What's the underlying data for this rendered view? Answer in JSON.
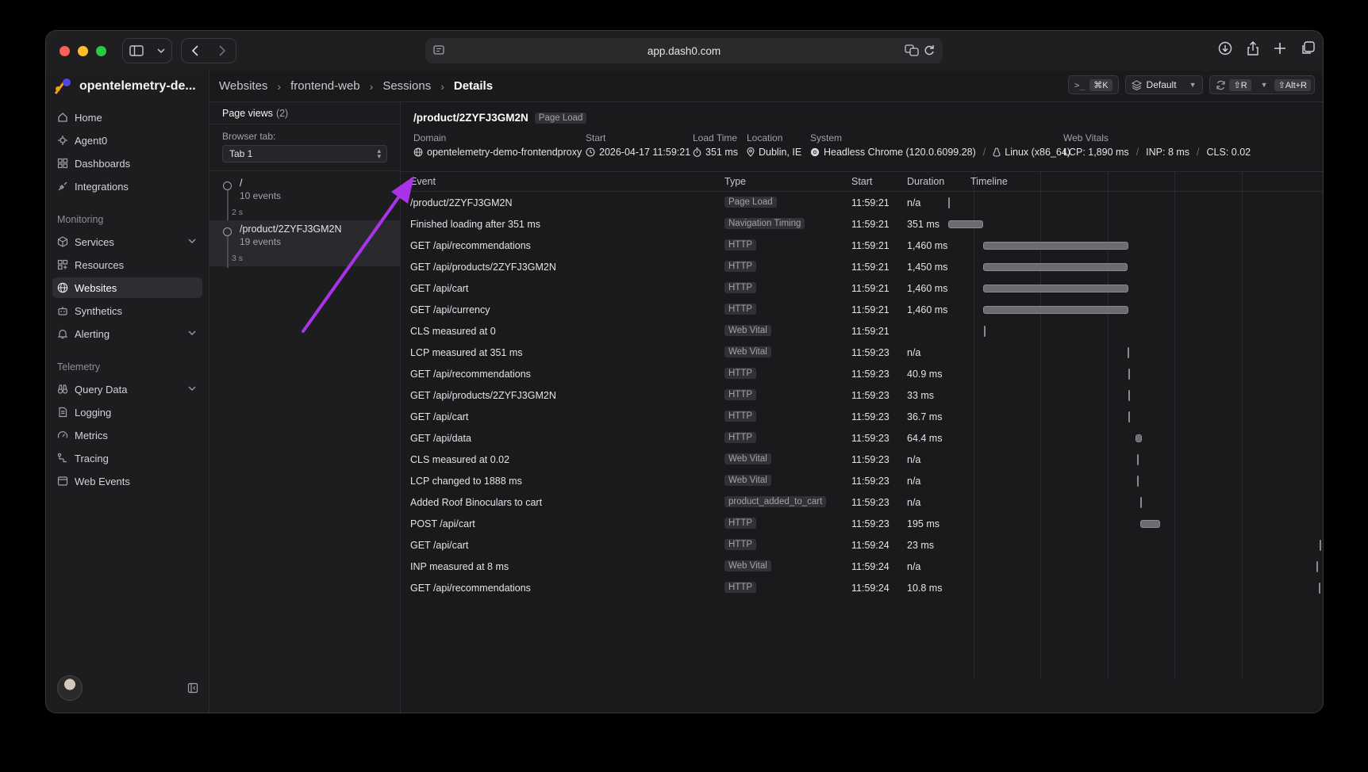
{
  "browser": {
    "url": "app.dash0.com"
  },
  "sidebar": {
    "org_name": "opentelemetry-de...",
    "main_items": [
      {
        "label": "Home",
        "icon": "home-icon"
      },
      {
        "label": "Agent0",
        "icon": "agent-icon"
      },
      {
        "label": "Dashboards",
        "icon": "dashboard-icon"
      },
      {
        "label": "Integrations",
        "icon": "plug-icon"
      }
    ],
    "monitoring_heading": "Monitoring",
    "monitoring_items": [
      {
        "label": "Services",
        "icon": "cube-icon",
        "expandable": true
      },
      {
        "label": "Resources",
        "icon": "grid-icon"
      },
      {
        "label": "Websites",
        "icon": "globe-icon",
        "active": true
      },
      {
        "label": "Synthetics",
        "icon": "robot-icon"
      },
      {
        "label": "Alerting",
        "icon": "bell-icon",
        "expandable": true
      }
    ],
    "telemetry_heading": "Telemetry",
    "telemetry_items": [
      {
        "label": "Query Data",
        "icon": "binoculars-icon",
        "expandable": true
      },
      {
        "label": "Logging",
        "icon": "log-icon"
      },
      {
        "label": "Metrics",
        "icon": "gauge-icon"
      },
      {
        "label": "Tracing",
        "icon": "trace-icon"
      },
      {
        "label": "Web Events",
        "icon": "window-icon"
      }
    ]
  },
  "breadcrumb": [
    "Websites",
    "frontend-web",
    "Sessions",
    "Details"
  ],
  "toolbar": {
    "command_kbd": "⌘K",
    "default_label": "Default",
    "refresh_kbd": "⇧R",
    "alt_kbd": "⇧Alt+R"
  },
  "page_views": {
    "title": "Page views",
    "count": "(2)",
    "browser_tab_label": "Browser tab:",
    "browser_tab_value": "Tab 1",
    "items": [
      {
        "path": "/",
        "events": "10 events",
        "duration": "2 s"
      },
      {
        "path": "/product/2ZYFJ3GM2N",
        "events": "19 events",
        "duration": "3 s"
      }
    ]
  },
  "detail": {
    "title": "/product/2ZYFJ3GM2N",
    "title_tag": "Page Load",
    "domain_label": "Domain",
    "domain_value": "opentelemetry-demo-frontendproxy",
    "start_label": "Start",
    "start_value": "2026-04-17 11:59:21",
    "load_label": "Load Time",
    "load_value": "351 ms",
    "location_label": "Location",
    "location_value": "Dublin, IE",
    "system_label": "System",
    "system_browser": "Headless Chrome (120.0.6099.28)",
    "system_os": "Linux (x86_64)",
    "vitals_label": "Web Vitals",
    "vitals_lcp": "LCP: 1,890 ms",
    "vitals_inp": "INP: 8 ms",
    "vitals_cls": "CLS: 0.02"
  },
  "table": {
    "headers": {
      "event": "Event",
      "type": "Type",
      "start": "Start",
      "duration": "Duration",
      "timeline": "Timeline"
    },
    "rows": [
      {
        "event": "/product/2ZYFJ3GM2N",
        "type": "Page Load",
        "start": "11:59:21",
        "duration": "n/a",
        "tl_start": 0,
        "tl_len": 0
      },
      {
        "event": "Finished loading after 351 ms",
        "type": "Navigation Timing",
        "start": "11:59:21",
        "duration": "351 ms",
        "tl_start": 0,
        "tl_len": 351
      },
      {
        "event": "GET /api/recommendations",
        "type": "HTTP",
        "start": "11:59:21",
        "duration": "1,460 ms",
        "tl_start": 351,
        "tl_len": 1460
      },
      {
        "event": "GET /api/products/2ZYFJ3GM2N",
        "type": "HTTP",
        "start": "11:59:21",
        "duration": "1,450 ms",
        "tl_start": 351,
        "tl_len": 1450
      },
      {
        "event": "GET /api/cart",
        "type": "HTTP",
        "start": "11:59:21",
        "duration": "1,460 ms",
        "tl_start": 351,
        "tl_len": 1460
      },
      {
        "event": "GET /api/currency",
        "type": "HTTP",
        "start": "11:59:21",
        "duration": "1,460 ms",
        "tl_start": 351,
        "tl_len": 1460
      },
      {
        "event": "CLS measured at 0",
        "type": "Web Vital",
        "start": "11:59:21",
        "duration": "",
        "tl_start": 360,
        "tl_len": 0
      },
      {
        "event": "LCP measured at 351 ms",
        "type": "Web Vital",
        "start": "11:59:23",
        "duration": "n/a",
        "tl_start": 1800,
        "tl_len": 0
      },
      {
        "event": "GET /api/recommendations",
        "type": "HTTP",
        "start": "11:59:23",
        "duration": "40.9 ms",
        "tl_start": 1810,
        "tl_len": 41
      },
      {
        "event": "GET /api/products/2ZYFJ3GM2N",
        "type": "HTTP",
        "start": "11:59:23",
        "duration": "33 ms",
        "tl_start": 1810,
        "tl_len": 33
      },
      {
        "event": "GET /api/cart",
        "type": "HTTP",
        "start": "11:59:23",
        "duration": "36.7 ms",
        "tl_start": 1810,
        "tl_len": 37
      },
      {
        "event": "GET /api/data",
        "type": "HTTP",
        "start": "11:59:23",
        "duration": "64.4 ms",
        "tl_start": 1880,
        "tl_len": 64
      },
      {
        "event": "CLS measured at 0.02",
        "type": "Web Vital",
        "start": "11:59:23",
        "duration": "n/a",
        "tl_start": 1895,
        "tl_len": 0
      },
      {
        "event": "LCP changed to 1888 ms",
        "type": "Web Vital",
        "start": "11:59:23",
        "duration": "n/a",
        "tl_start": 1895,
        "tl_len": 0
      },
      {
        "event": "Added Roof Binoculars to cart",
        "type": "product_added_to_cart",
        "start": "11:59:23",
        "duration": "n/a",
        "tl_start": 1930,
        "tl_len": 0
      },
      {
        "event": "POST /api/cart",
        "type": "HTTP",
        "start": "11:59:23",
        "duration": "195 ms",
        "tl_start": 1930,
        "tl_len": 195
      },
      {
        "event": "GET /api/cart",
        "type": "HTTP",
        "start": "11:59:24",
        "duration": "23 ms",
        "tl_start": 3730,
        "tl_len": 0
      },
      {
        "event": "INP measured at 8 ms",
        "type": "Web Vital",
        "start": "11:59:24",
        "duration": "n/a",
        "tl_start": 3700,
        "tl_len": 0
      },
      {
        "event": "GET /api/recommendations",
        "type": "HTTP",
        "start": "11:59:24",
        "duration": "10.8 ms",
        "tl_start": 3720,
        "tl_len": 0
      }
    ]
  }
}
